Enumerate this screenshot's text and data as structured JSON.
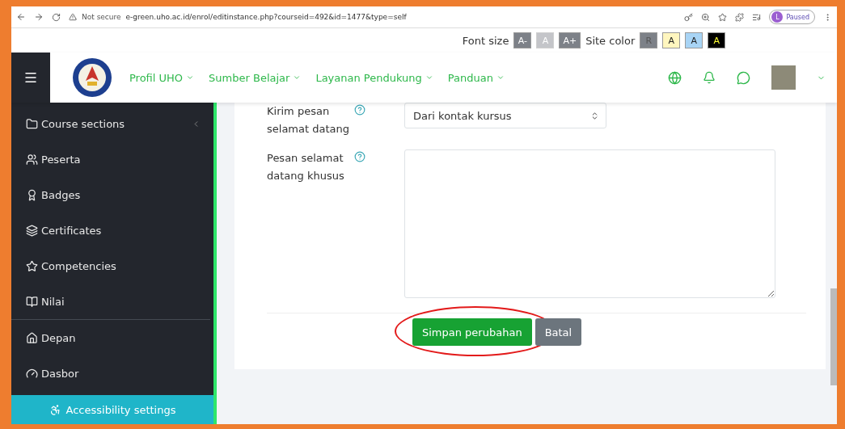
{
  "browser": {
    "security": "Not secure",
    "url": "e-green.uho.ac.id/enrol/editinstance.php?courseid=492&id=1477&type=self",
    "profile_initial": "L",
    "profile_status": "Paused"
  },
  "accessibility_bar": {
    "font_size_label": "Font size",
    "font_buttons": [
      {
        "label": "A-",
        "disabled": false
      },
      {
        "label": "A",
        "disabled": true
      },
      {
        "label": "A+",
        "disabled": false
      }
    ],
    "site_color_label": "Site color",
    "color_buttons": [
      {
        "label": "R",
        "color": "#7d8188"
      },
      {
        "label": "A",
        "color": "#fff6bf"
      },
      {
        "label": "A",
        "color": "#a8d4f5"
      },
      {
        "label": "A",
        "color": "#000000"
      }
    ]
  },
  "navbar": {
    "menu": [
      "Profil UHO",
      "Sumber Belajar",
      "Layanan Pendukung",
      "Panduan"
    ]
  },
  "sidebar": {
    "sections": [
      {
        "items": [
          {
            "label": "Course sections",
            "kind": "folder"
          },
          {
            "label": "Peserta",
            "kind": "users"
          },
          {
            "label": "Badges",
            "kind": "badge"
          },
          {
            "label": "Certificates",
            "kind": "layers"
          },
          {
            "label": "Competencies",
            "kind": "star"
          },
          {
            "label": "Nilai",
            "kind": "book"
          }
        ]
      },
      {
        "items": [
          {
            "label": "Depan",
            "kind": "home"
          },
          {
            "label": "Dasbor",
            "kind": "gauge"
          }
        ]
      }
    ],
    "footer": "Accessibility settings"
  },
  "form": {
    "fields": [
      {
        "kind": "select",
        "label": "Kirim pesan selamat datang",
        "value": "Dari kontak kursus"
      },
      {
        "kind": "textarea",
        "label": "Pesan selamat datang khusus"
      }
    ],
    "buttons": [
      {
        "label": "Simpan perubahan",
        "kind": "primary",
        "circled": true
      },
      {
        "label": "Batal",
        "kind": "secondary",
        "circled": false
      }
    ]
  }
}
